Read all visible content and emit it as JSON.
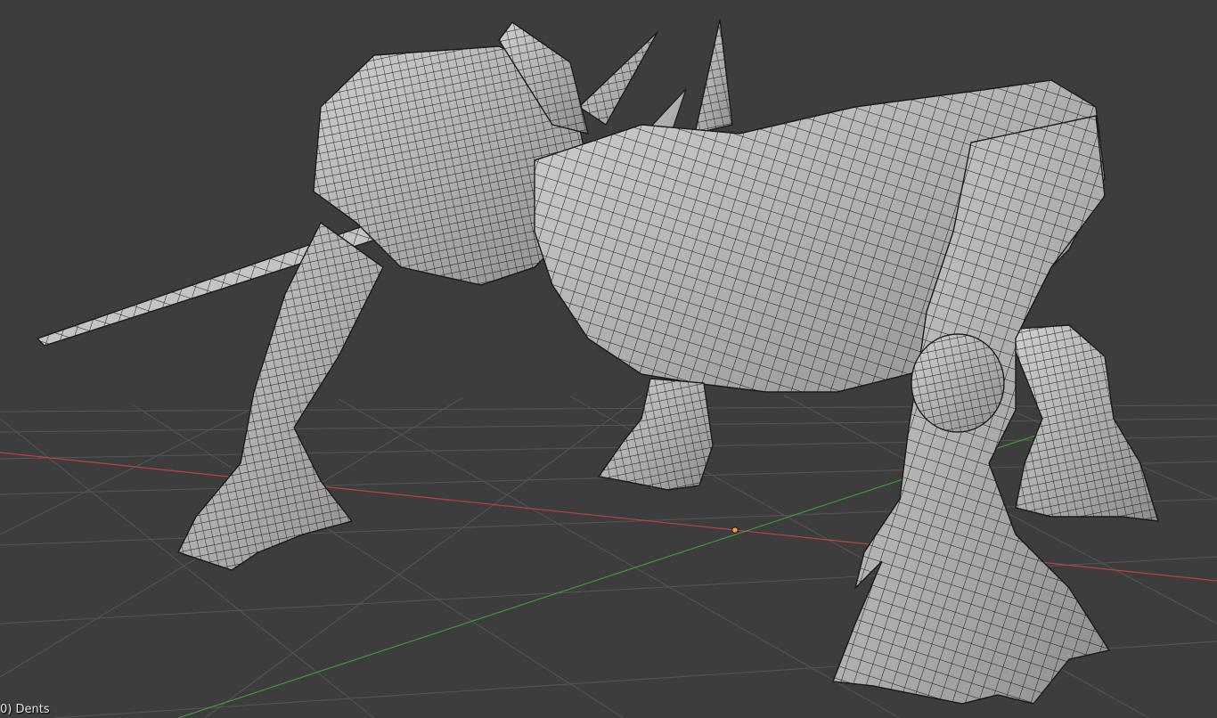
{
  "viewport": {
    "background_color": "#3d3d3d",
    "grid_color": "#555555",
    "x_axis_color": "#c04040",
    "y_axis_color": "#3c9a3c",
    "origin_color": "#e8a040",
    "mesh_fill_color": "#b6b6b6",
    "mesh_wire_color": "#1a1a1a",
    "object_info": "0) Dents"
  }
}
